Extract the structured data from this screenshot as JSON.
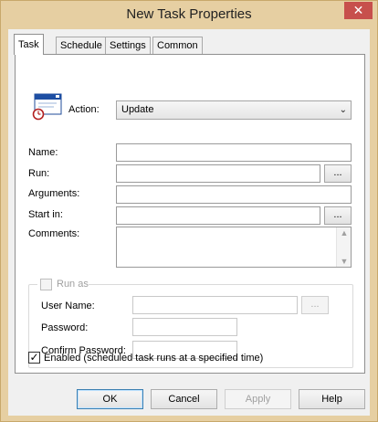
{
  "window": {
    "title": "New Task Properties",
    "close_glyph": "✕"
  },
  "tabs": [
    {
      "label": "Task",
      "active": true
    },
    {
      "label": "Schedule",
      "active": false
    },
    {
      "label": "Settings",
      "active": false
    },
    {
      "label": "Common",
      "active": false
    }
  ],
  "task": {
    "action_label": "Action:",
    "action_value": "Update",
    "name_label": "Name:",
    "name_value": "",
    "run_label": "Run:",
    "run_value": "",
    "run_browse": "...",
    "arguments_label": "Arguments:",
    "arguments_value": "",
    "startin_label": "Start in:",
    "startin_value": "",
    "startin_browse": "...",
    "comments_label": "Comments:",
    "comments_value": ""
  },
  "runas": {
    "label": "Run as",
    "checked": false,
    "username_label": "User Name:",
    "username_value": "",
    "username_browse": "...",
    "password_label": "Password:",
    "confirm_label": "Confirm Password:"
  },
  "enabled": {
    "label": "Enabled (scheduled task runs at a specified time)",
    "checked": true,
    "check_glyph": "✓"
  },
  "buttons": {
    "ok": "OK",
    "cancel": "Cancel",
    "apply": "Apply",
    "help": "Help"
  },
  "icons": {
    "chevron": "⌄",
    "scroll_up": "▲",
    "scroll_down": "▼"
  },
  "colors": {
    "frame": "#e6cfa2",
    "close": "#c7504c",
    "default_button_border": "#3c7fb1"
  }
}
